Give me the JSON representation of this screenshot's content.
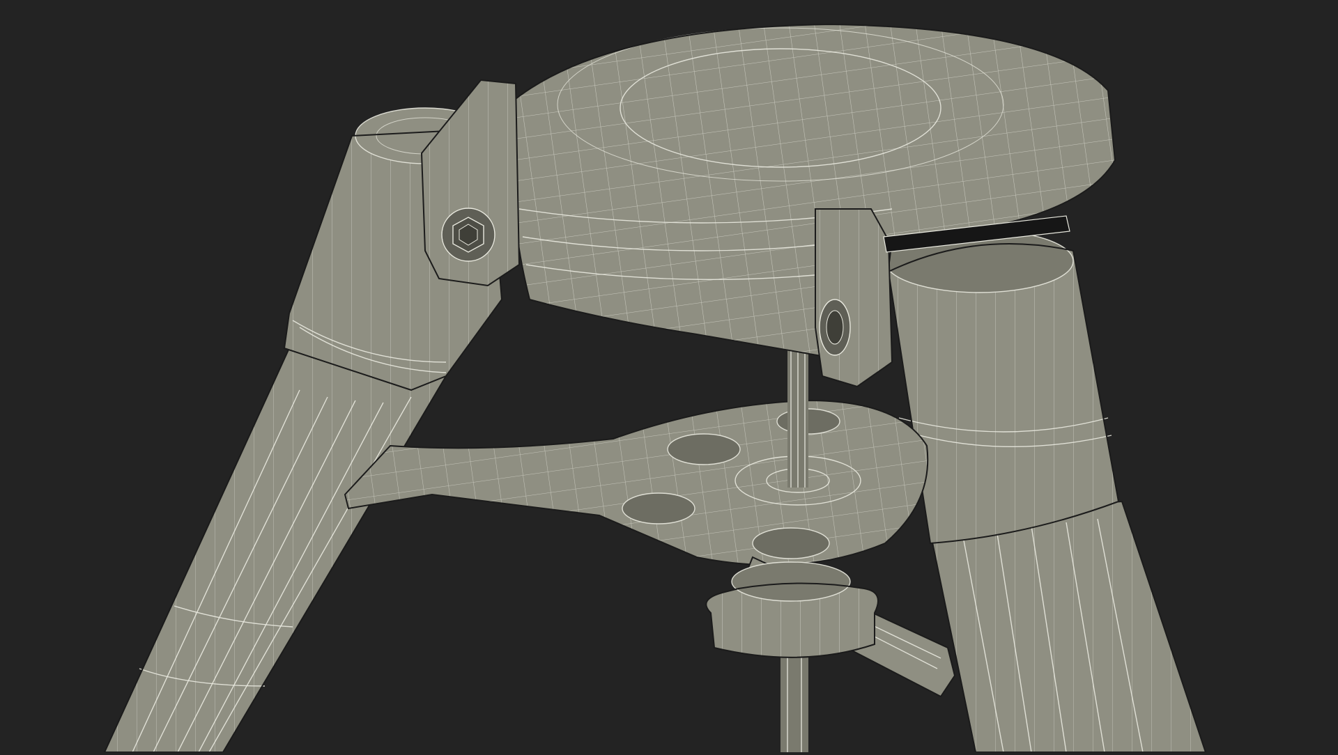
{
  "scene": {
    "background": "#232323",
    "mesh_color": "#8f8f82",
    "wireframe_color": "#e9e9df"
  }
}
